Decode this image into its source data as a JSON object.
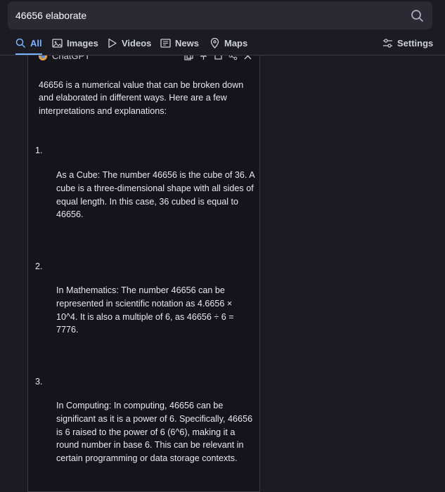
{
  "search": {
    "query": "46656 elaborate"
  },
  "tabs": [
    {
      "label": "All",
      "icon": "search-icon"
    },
    {
      "label": "Images",
      "icon": "image-icon"
    },
    {
      "label": "Videos",
      "icon": "play-icon"
    },
    {
      "label": "News",
      "icon": "newspaper-icon"
    },
    {
      "label": "Maps",
      "icon": "map-pin-icon"
    }
  ],
  "settings": {
    "label": "Settings",
    "icon": "sliders-icon"
  },
  "panel": {
    "title": "ChatGPT",
    "intro": "46656 is a numerical value that can be broken down and elaborated in different ways. Here are a few interpretations and explanations:",
    "items": [
      {
        "number": "1.",
        "text": "As a Cube: The number 46656 is the cube of 36. A cube is a three-dimensional shape with all sides of equal length. In this case, 36 cubed is equal to 46656."
      },
      {
        "number": "2.",
        "text": "In Mathematics: The number 46656 can be represented in scientific notation as 4.6656 × 10^4. It is also a multiple of 6, as 46656 ÷ 6 = 7776."
      },
      {
        "number": "3.",
        "text": "In Computing: In computing, 46656 can be significant as it is a power of 6. Specifically, 46656 is 6 raised to the power of 6 (6^6), making it a round number in base 6. This can be relevant in certain programming or data storage contexts."
      }
    ]
  }
}
